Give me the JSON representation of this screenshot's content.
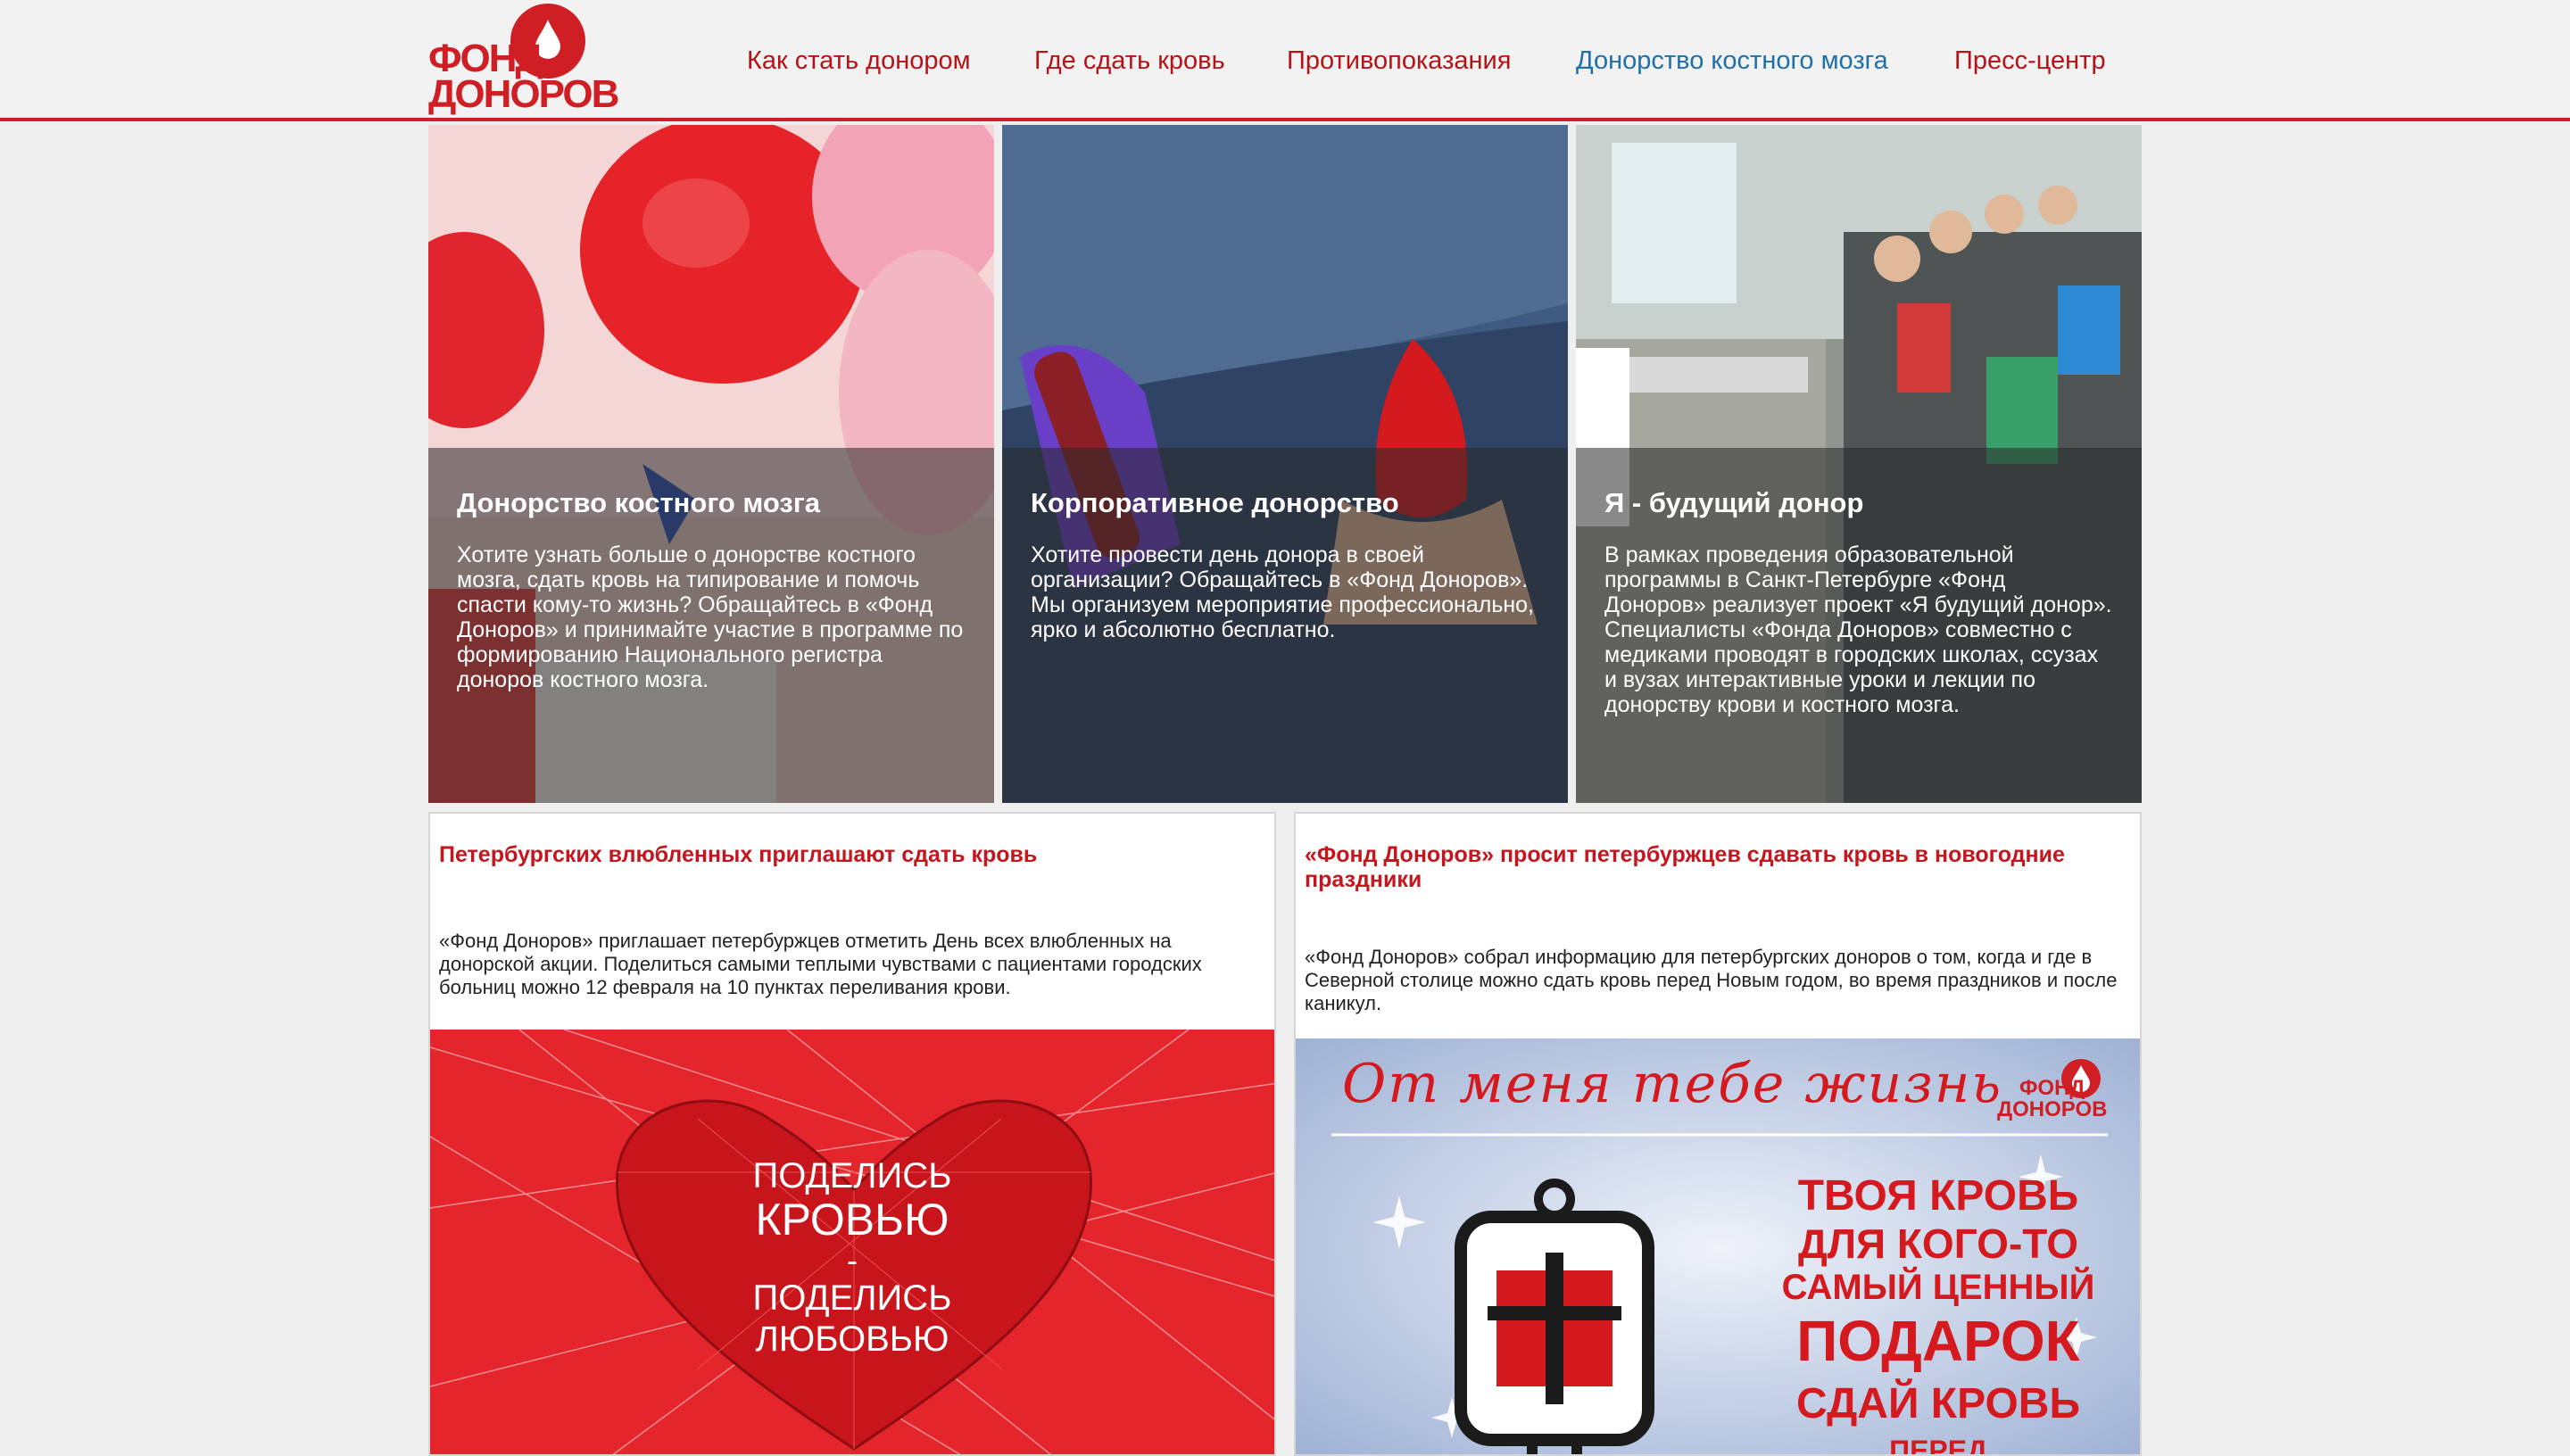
{
  "header": {
    "logo": {
      "line1": "ФОНД",
      "line2": "ДОНОРОВ",
      "alt": "logo-drop-icon"
    },
    "nav": [
      {
        "label": "Как стать донором",
        "active": false
      },
      {
        "label": "Где сдать кровь",
        "active": false
      },
      {
        "label": "Противопоказания",
        "active": false
      },
      {
        "label": "Донорство костного мозга",
        "active": true
      },
      {
        "label": "Пресс-центр",
        "active": false
      }
    ]
  },
  "tiles": [
    {
      "title": "Донорство костного мозга",
      "text": "Хотите узнать больше о донорстве костного мозга, сдать кровь на типирование и помочь спасти кому-то жизнь? Обращайтесь в «Фонд Доноров» и принимайте участие в программе по формированию Национального регистра доноров костного мозга."
    },
    {
      "title": "Корпоративное донорство",
      "text": "Хотите провести день донора в своей организации? Обращайтесь в «Фонд Доноров». Мы организуем мероприятие профессионально, ярко и абсолютно бесплатно."
    },
    {
      "title": "Я - будущий донор",
      "text": "В рамках проведения образовательной программы в Санкт-Петербурге «Фонд Доноров» реализует проект «Я будущий донор». Специалисты «Фонда Доноров» совместно с медиками проводят в городских школах, ссузах и вузах интерактивные уроки и лекции по донорству крови и костного мозга."
    }
  ],
  "news": [
    {
      "title": "Петербургских влюбленных приглашают сдать кровь",
      "lead": "«Фонд Доноров» приглашает петербуржцев отметить День всех влюбленных на донорской акции. Поделиться самыми теплыми чувствами с пациентами городских больниц можно 12 февраля на 10 пунктах переливания крови.",
      "banner_lines": [
        "ПОДЕЛИСЬ",
        "КРОВЬЮ",
        "-",
        "ПОДЕЛИСЬ",
        "ЛЮБОВЬЮ"
      ]
    },
    {
      "title": "«Фонд Доноров» просит петербуржцев сдавать кровь в новогодние праздники",
      "lead": "«Фонд Доноров» собрал информацию для петербургских доноров о том, когда и где в Северной столице можно сдать кровь перед Новым годом, во время праздников и после каникул.",
      "banner_script": "От меня тебе жизнь",
      "banner_logo": [
        "ФОНД",
        "ДОНОРОВ"
      ],
      "banner_lines": [
        "ТВОЯ КРОВЬ",
        "ДЛЯ КОГО-ТО",
        "САМЫЙ ЦЕННЫЙ",
        "ПОДАРОК",
        "СДАЙ КРОВЬ",
        "ПЕРЕД ПРАЗДНИКАМИ"
      ]
    }
  ],
  "colors": {
    "brand_red": "#cf1f25",
    "nav_red": "#b81216",
    "nav_active": "#1f6fa8"
  }
}
